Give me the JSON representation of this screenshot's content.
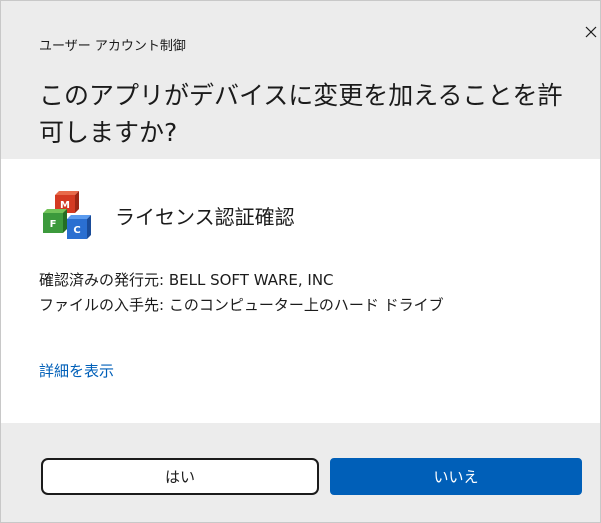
{
  "dialog": {
    "title": "ユーザー アカウント制御",
    "close_icon": "close-icon",
    "question": "このアプリがデバイスに変更を加えることを許可しますか?"
  },
  "app": {
    "icon": "mfc-app-icon",
    "name": "ライセンス認証確認",
    "publisher": "確認済みの発行元: BELL SOFT WARE, INC",
    "origin": "ファイルの入手先: このコンピューター上のハード ドライブ"
  },
  "details_link": "詳細を表示",
  "buttons": {
    "yes": "はい",
    "no": "いいえ"
  },
  "colors": {
    "header_bg": "#ececec",
    "accent": "#005fb8",
    "text": "#1b1b1b"
  }
}
